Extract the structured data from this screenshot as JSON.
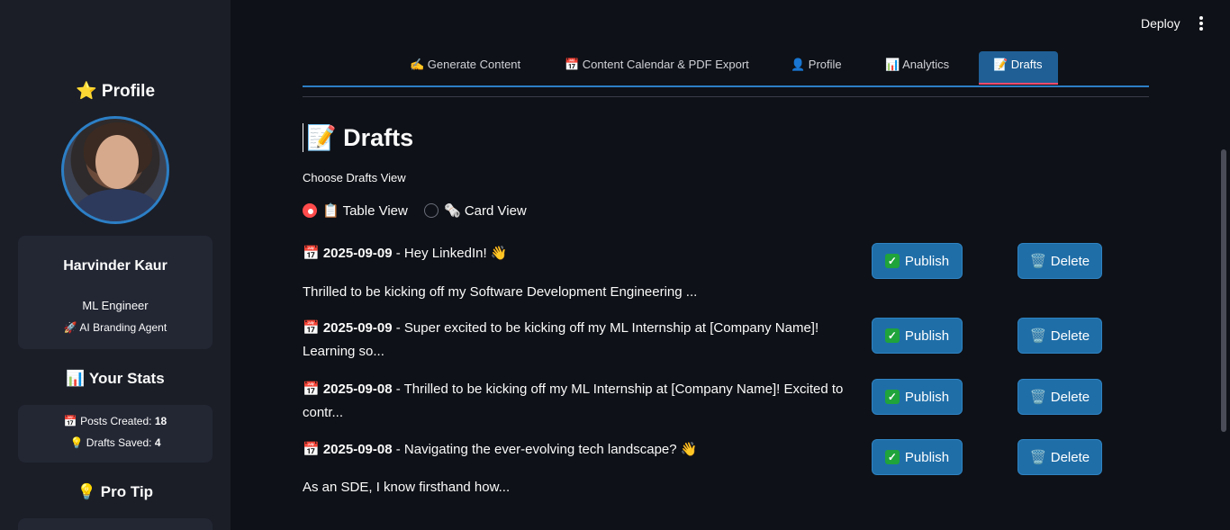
{
  "sidebar": {
    "profile_heading": "⭐ Profile",
    "name": "Harvinder Kaur",
    "role": "ML Engineer",
    "agent": "🚀 AI Branding Agent",
    "stats_heading": "📊 Your Stats",
    "posts_created_label": "📅 Posts Created: ",
    "posts_created_value": "18",
    "drafts_saved_label": "💡 Drafts Saved: ",
    "drafts_saved_value": "4",
    "pro_tip_heading": "💡 Pro Tip"
  },
  "topbar": {
    "deploy": "Deploy"
  },
  "tabs": [
    {
      "label": "✍️ Generate Content"
    },
    {
      "label": "📅 Content Calendar & PDF Export"
    },
    {
      "label": "👤 Profile"
    },
    {
      "label": "📊 Analytics"
    },
    {
      "label": "📝 Drafts",
      "active": true
    }
  ],
  "main": {
    "title": "📝 Drafts",
    "choose_label": "Choose Drafts View",
    "view_options": [
      {
        "label": "📋 Table View",
        "selected": true
      },
      {
        "label": "🗞️ Card View",
        "selected": false
      }
    ],
    "publish_label": "Publish",
    "delete_label": "🗑️ Delete",
    "drafts": [
      {
        "date": "📅 2025-09-09",
        "headline": " - Hey LinkedIn! 👋",
        "body": "Thrilled to be kicking off my Software Development Engineering ..."
      },
      {
        "date": "📅 2025-09-09",
        "headline": " - Super excited to be kicking off my ML Internship at [Company Name]! Learning so...",
        "body": ""
      },
      {
        "date": "📅 2025-09-08",
        "headline": " - Thrilled to be kicking off my ML Internship at [Company Name]! Excited to contr...",
        "body": ""
      },
      {
        "date": "📅 2025-09-08",
        "headline": " - Navigating the ever-evolving tech landscape? 👋",
        "body": "As an SDE, I know firsthand how..."
      }
    ]
  },
  "colors": {
    "accent": "#1f6ea8",
    "active_tab_underline": "#ff4b6e",
    "radio_selected": "#ff4b4b"
  }
}
